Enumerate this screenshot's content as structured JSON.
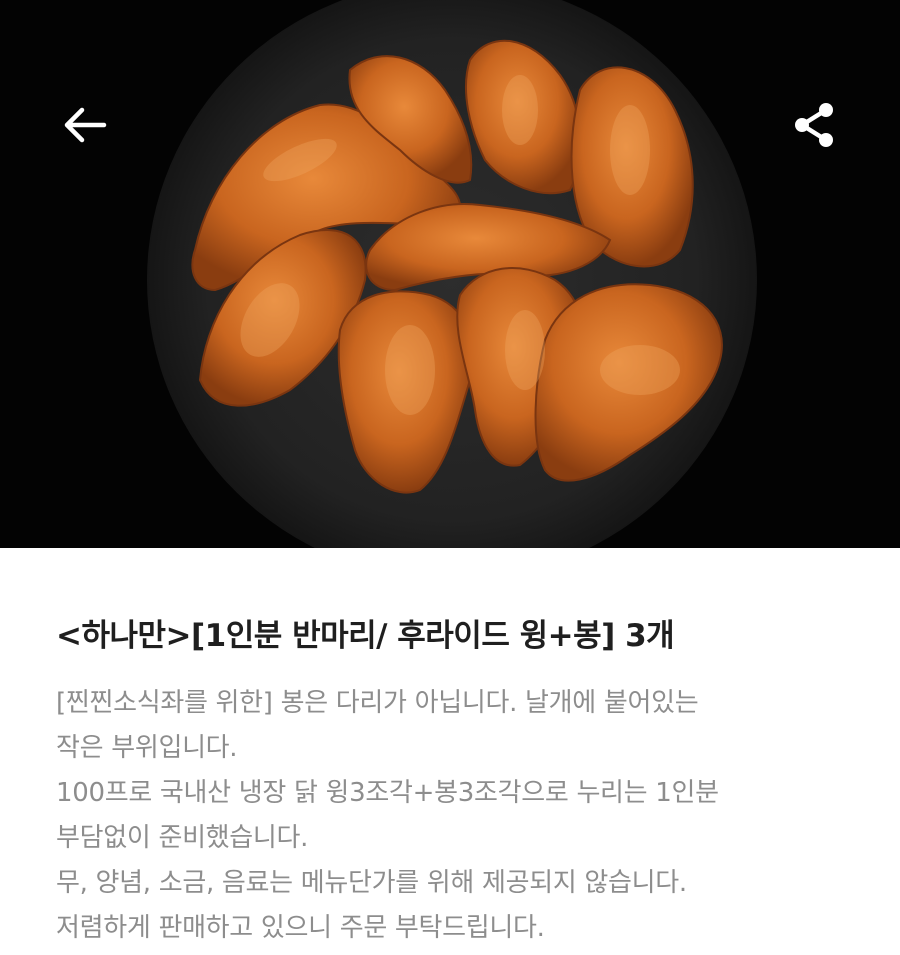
{
  "header": {
    "back_icon": "arrow-left-icon",
    "share_icon": "share-icon"
  },
  "product": {
    "image_alt": "",
    "title": "<하나만>[1인분 반마리/ 후라이드 윙+봉] 3개",
    "description_lines": [
      "[찐찐소식좌를 위한] 봉은 다리가 아닙니다. 날개에 붙어있는",
      "작은 부위입니다.",
      "100프로 국내산 냉장 닭 윙3조각+봉3조각으로 누리는 1인분",
      "부담없이 준비했습니다.",
      "무, 양념, 소금, 음료는 메뉴단가를 위해 제공되지 않습니다.",
      "저렴하게 판매하고 있으니 주문 부탁드립니다."
    ]
  },
  "colors": {
    "title": "#1f1f1f",
    "description": "#8d8d8d",
    "hero_background": "#000000"
  }
}
